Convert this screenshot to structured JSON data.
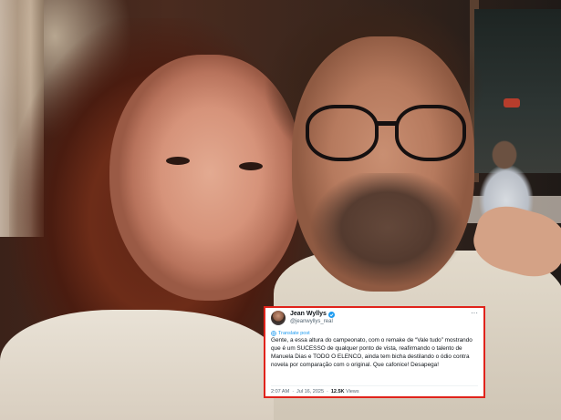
{
  "tweet": {
    "display_name": "Jean Wyllys",
    "handle": "@jeanwyllys_real",
    "translate_label": "Translate post",
    "text": "Gente, a essa altura do campeonato, com o remake de “Vale tudo” mostrando que é um SUCESSO de qualquer ponto de vista, reafirmando o talento de Manuela Dias e TODO O ELENCO, ainda tem bicha destilando o ódio contra novela por comparação com o original. Que cafonice! Desapega!",
    "time": "2:07 AM",
    "date": "Jul 16, 2025",
    "separator": "·",
    "views_count": "12.5K",
    "views_label": "Views",
    "more_icon": "ellipsis-icon",
    "verified_icon": "verified-badge-icon",
    "accent_color": "#1d9bf0",
    "highlight_border_color": "#e0231b"
  }
}
